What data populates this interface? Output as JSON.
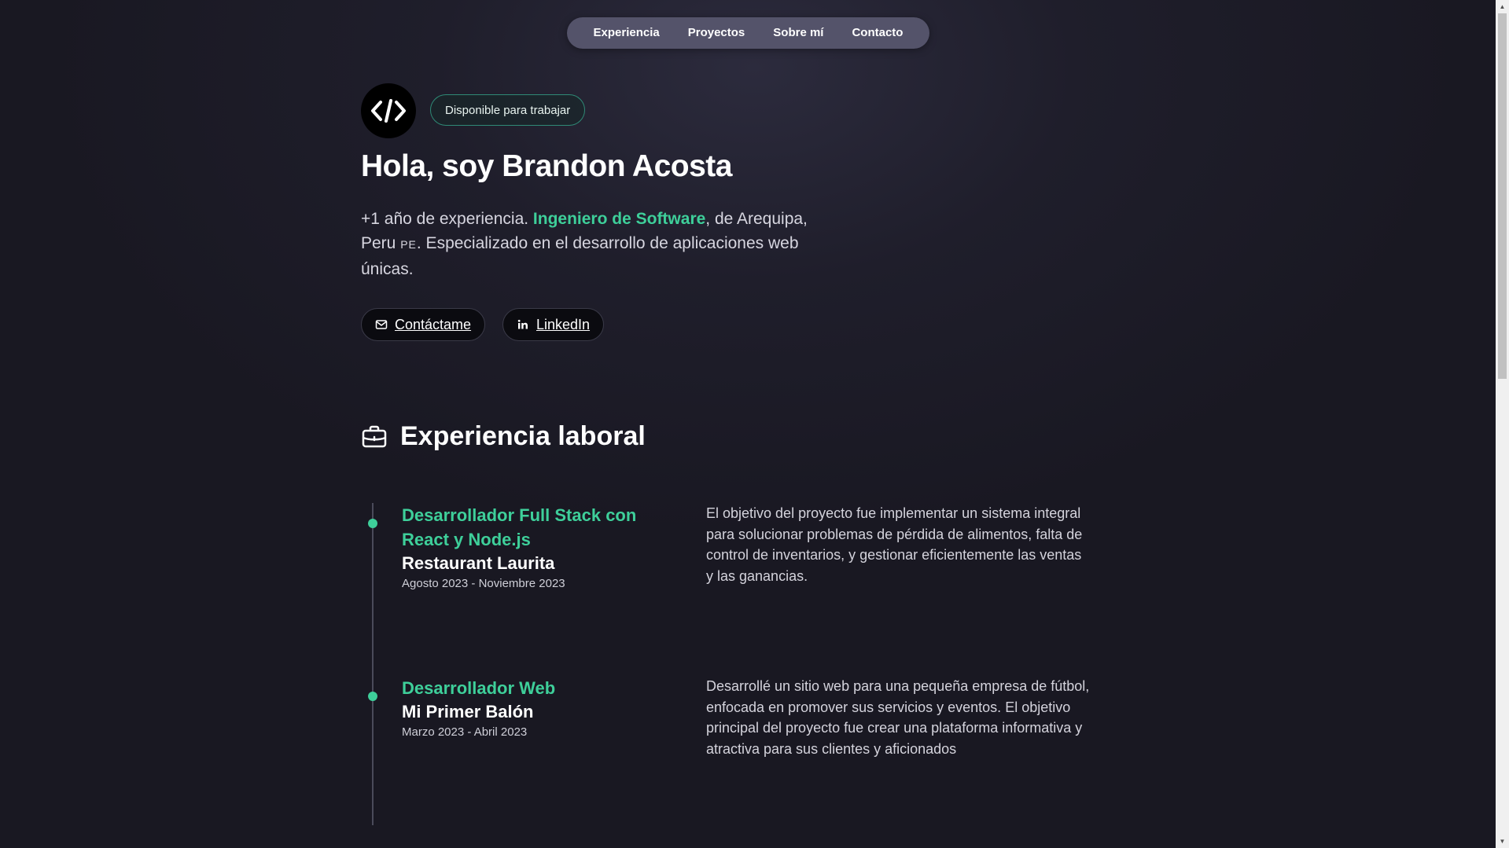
{
  "nav": {
    "items": [
      "Experiencia",
      "Proyectos",
      "Sobre mí",
      "Contacto"
    ]
  },
  "hero": {
    "avatar_icon": "code-brackets-icon",
    "badge": "Disponible para trabajar",
    "title": "Hola, soy Brandon Acosta",
    "desc_part1": "+1 año de experiencia. ",
    "desc_accent": "Ingeniero de Software",
    "desc_part2": ", de Arequipa, Peru ",
    "desc_flag": "PE",
    "desc_part3": ". Especializado en el desarrollo de aplicaciones web únicas.",
    "contact_label": "Contáctame",
    "contact_icon": "mail-icon",
    "linkedin_label": "LinkedIn",
    "linkedin_icon": "linkedin-icon"
  },
  "experience": {
    "title": "Experiencia laboral",
    "icon": "briefcase-icon",
    "jobs": [
      {
        "role": "Desarrollador Full Stack con React y Node.js",
        "company": "Restaurant Laurita",
        "date": "Agosto 2023 - Noviembre 2023",
        "description": "El objetivo del proyecto fue implementar un sistema integral para solucionar problemas de pérdida de alimentos, falta de control de inventarios, y gestionar eficientemente las ventas y las ganancias."
      },
      {
        "role": "Desarrollador Web",
        "company": "Mi Primer Balón",
        "date": "Marzo 2023 - Abril 2023",
        "description": "Desarrollé un sitio web para una pequeña empresa de fútbol, enfocada en promover sus servicios y eventos. El objetivo principal del proyecto fue crear una plataforma informativa y atractiva para sus clientes y aficionados"
      }
    ]
  },
  "colors": {
    "accent": "#3ecf9a",
    "nav_bg": "#54536a",
    "background": "#1f1e2b"
  }
}
